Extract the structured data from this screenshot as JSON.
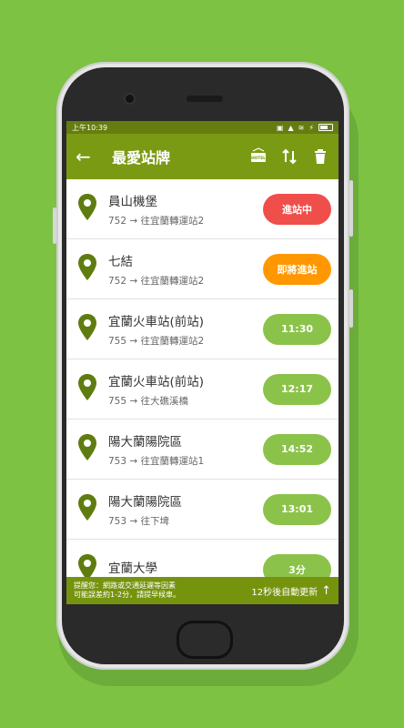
{
  "status_bar": {
    "time": "上午10:39"
  },
  "app": {
    "title": "最愛站牌",
    "hotel_icon_text": "HOTEL"
  },
  "stops": [
    {
      "name": "員山機堡",
      "route": "752 → 往宜蘭轉運站2",
      "status": "進站中",
      "color": "#f04e4a"
    },
    {
      "name": "七結",
      "route": "752 → 往宜蘭轉運站2",
      "status": "即將進站",
      "color": "#ff9800"
    },
    {
      "name": "宜蘭火車站(前站)",
      "route": "755 → 往宜蘭轉運站2",
      "status": "11:30",
      "color": "#8bc34a"
    },
    {
      "name": "宜蘭火車站(前站)",
      "route": "755 → 往大礁溪橋",
      "status": "12:17",
      "color": "#8bc34a"
    },
    {
      "name": "陽大蘭陽院區",
      "route": "753 → 往宜蘭轉運站1",
      "status": "14:52",
      "color": "#8bc34a"
    },
    {
      "name": "陽大蘭陽院區",
      "route": "753 → 往下埤",
      "status": "13:01",
      "color": "#8bc34a"
    },
    {
      "name": "宜蘭大學",
      "route": "",
      "status": "3分",
      "color": "#8bc34a"
    }
  ],
  "notice": {
    "line1": "提醒您：網路或交通延遲等因素",
    "line2": "可能誤差約1-2分，請提早候車。",
    "refresh": "12秒後自動更新"
  },
  "colors": {
    "background": "#7dc243",
    "toolbar": "#7b9a14",
    "pin": "#5f7c10"
  }
}
